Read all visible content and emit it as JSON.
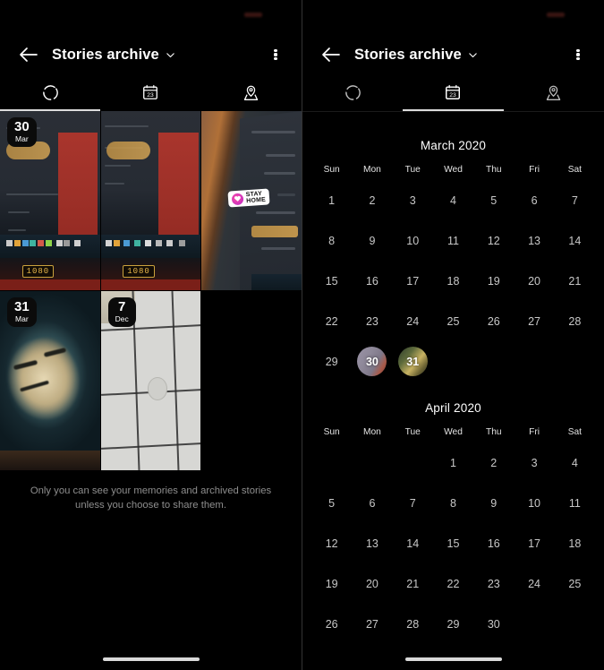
{
  "app": {
    "header": {
      "title": "Stories archive",
      "back_icon": "back-arrow-icon",
      "chevron_icon": "chevron-down-icon",
      "menu_icon": "more-options-icon"
    },
    "tabs": [
      {
        "id": "stories",
        "icon": "stories-circle-icon",
        "label": "Stories",
        "active_left": true,
        "active_right": false
      },
      {
        "id": "calendar",
        "icon": "calendar-23-icon",
        "label": "Calendar",
        "active_left": false,
        "active_right": true
      },
      {
        "id": "map",
        "icon": "location-pin-icon",
        "label": "Map",
        "active_left": false,
        "active_right": false
      }
    ]
  },
  "left_panel": {
    "stories": [
      {
        "day": "30",
        "month": "Mar",
        "kind": "laptop-screen"
      },
      {
        "day": "",
        "month": "",
        "kind": "laptop-screen-2"
      },
      {
        "day": "",
        "month": "",
        "kind": "angled-screen-sticker",
        "sticker_line1": "STAY",
        "sticker_line2": "HOME"
      },
      {
        "day": "31",
        "month": "Mar",
        "kind": "face-photo"
      },
      {
        "day": "7",
        "month": "Dec",
        "kind": "tiles-photo"
      }
    ],
    "footnote": "Only you can see your memories and archived stories unless you choose to share them."
  },
  "right_panel": {
    "weekday_labels": [
      "Sun",
      "Mon",
      "Tue",
      "Wed",
      "Thu",
      "Fri",
      "Sat"
    ],
    "months": [
      {
        "title": "March 2020",
        "lead_blanks": 0,
        "days": [
          1,
          2,
          3,
          4,
          5,
          6,
          7,
          8,
          9,
          10,
          11,
          12,
          13,
          14,
          15,
          16,
          17,
          18,
          19,
          20,
          21,
          22,
          23,
          24,
          25,
          26,
          27,
          28,
          29,
          30,
          31
        ],
        "story_days": [
          {
            "day": 30,
            "thumb_class": "sd-30"
          },
          {
            "day": 31,
            "thumb_class": "sd-31"
          }
        ]
      },
      {
        "title": "April 2020",
        "lead_blanks": 3,
        "days": [
          1,
          2,
          3,
          4,
          5,
          6,
          7,
          8,
          9,
          10,
          11,
          12,
          13,
          14,
          15,
          16,
          17,
          18,
          19,
          20,
          21,
          22,
          23,
          24,
          25,
          26,
          27,
          28,
          29,
          30
        ],
        "story_days": []
      }
    ]
  },
  "colors": {
    "background": "#000000",
    "text_primary": "#ffffff",
    "text_secondary": "#c8c8c8",
    "text_muted": "#8e8e8e",
    "tab_indicator": "#dcdcdc",
    "home_bar": "#d9d9d9"
  }
}
